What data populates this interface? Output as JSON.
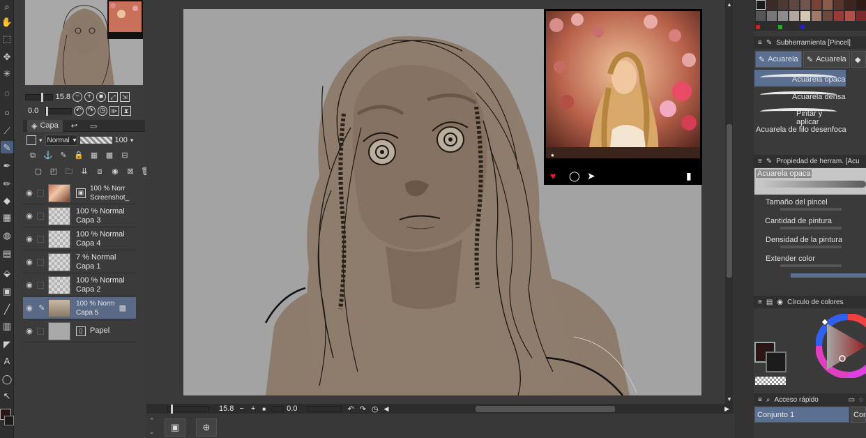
{
  "navigator": {
    "zoom": "15.8",
    "rotation": "0.0"
  },
  "layers": {
    "tab_label": "Capa",
    "blend_mode": "Normal",
    "opacity": "100",
    "items": [
      {
        "line1": "100 % Norr",
        "line2": "Screenshot_",
        "kind": "photo"
      },
      {
        "line1": "100 % Normal",
        "line2": "Capa 3",
        "kind": "empty"
      },
      {
        "line1": "100 % Normal",
        "line2": "Capa 4",
        "kind": "empty"
      },
      {
        "line1": "7 % Normal",
        "line2": "Capa 1",
        "kind": "empty"
      },
      {
        "line1": "100 % Normal",
        "line2": "Capa 2",
        "kind": "empty"
      },
      {
        "line1": "100 % Norm",
        "line2": "Capa 5",
        "kind": "draw",
        "selected": true
      },
      {
        "line1": "",
        "line2": "Papel",
        "kind": "paper"
      }
    ]
  },
  "status_bar": {
    "zoom": "15.8",
    "angle": "0.0"
  },
  "subtool": {
    "title": "Subherramienta [Pincel]",
    "tabs": [
      "Acuarela",
      "Acuarela"
    ],
    "items": [
      "Acuarela opaca",
      "Acuarela densa",
      "Pintar y aplicar",
      "Acuarela de filo desenfoca"
    ]
  },
  "tool_property": {
    "title": "Propiedad de herram. [Acu",
    "preset": "Acuarela opaca",
    "properties": [
      "Tamaño del pincel",
      "Cantidad de pintura",
      "Densidad de la pintura",
      "Extender color"
    ]
  },
  "color_wheel": {
    "title": "Círculo de colores",
    "main_color": "#2a1614",
    "sub_color": "#1c1c1c"
  },
  "quick_access": {
    "title": "Acceso rápido",
    "items": [
      "Conjunto 1",
      "Conj"
    ]
  },
  "colors": {
    "accent": "#5b6f90",
    "canvas_bg": "#a3a3a3",
    "skin": "#8c7b6b"
  }
}
